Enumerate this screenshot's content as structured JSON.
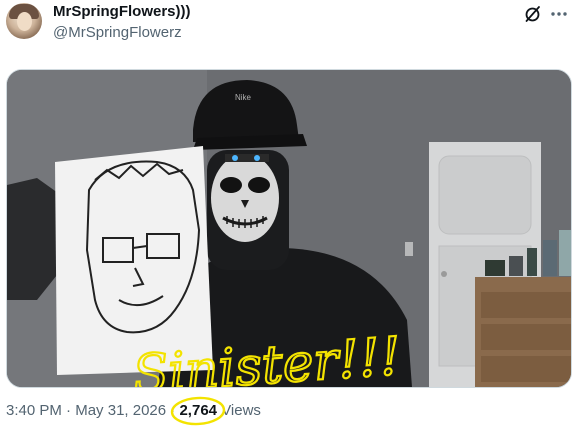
{
  "post": {
    "author_name": "MrSpringFlowers)))",
    "author_handle": "@MrSpringFlowerz",
    "grok_icon": "grok-slash-circle-icon",
    "more_icon": "more-dots-icon",
    "time": "3:40 PM",
    "separator": "·",
    "date": "May 31, 2026",
    "views_count": "2,764",
    "views_label": "Views"
  },
  "media": {
    "cap_logo": "Nike",
    "overlay_text": "Sinister!!!",
    "annotation_color": "#f3e300"
  }
}
